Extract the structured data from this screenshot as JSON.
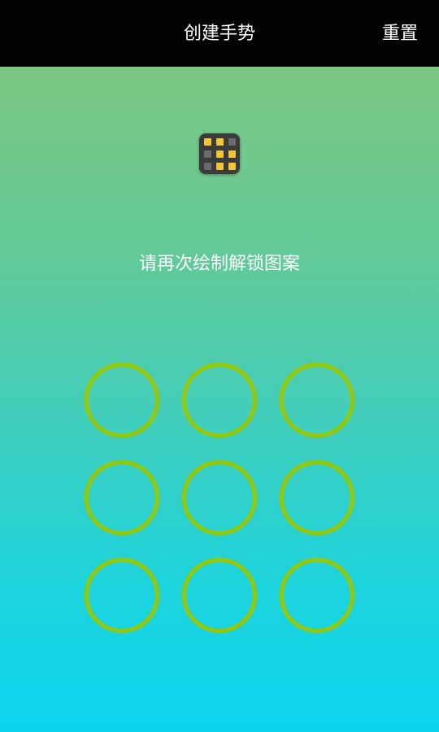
{
  "topbar": {
    "title": "创建手势",
    "reset_label": "重置"
  },
  "pattern_preview": {
    "cells": [
      "on",
      "on",
      "off",
      "off",
      "on",
      "on",
      "off",
      "on",
      "on"
    ],
    "colors": {
      "on": "#f3c536",
      "off": "#6b6b6b"
    }
  },
  "hint_text": "请再次绘制解锁图案",
  "grid": {
    "node_count": 9,
    "ring_color": "#94c80a"
  },
  "background": {
    "top_color": "#80c680",
    "bottom_color": "#0cd4ef"
  }
}
